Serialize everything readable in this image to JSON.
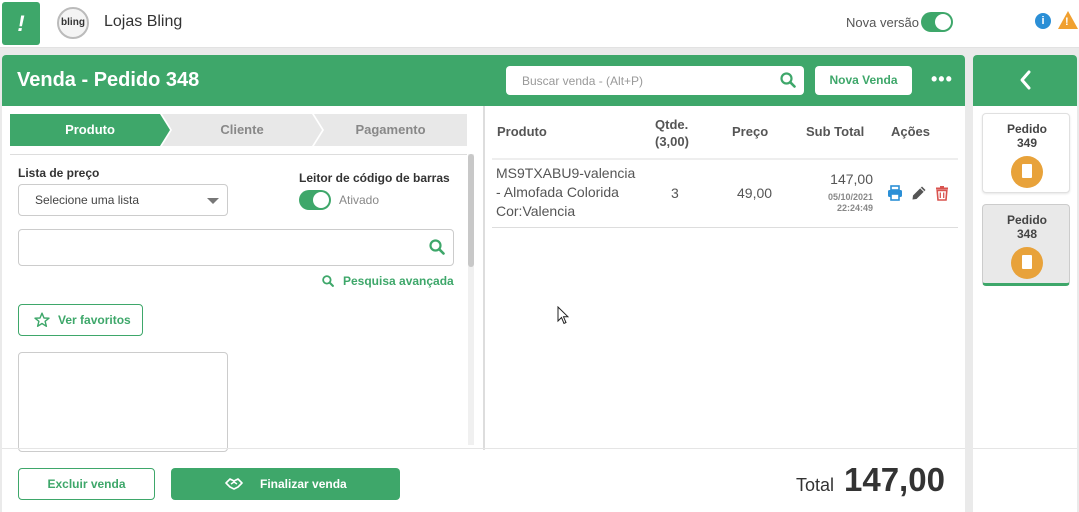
{
  "topbar": {
    "brand_icon": "!",
    "logo_text": "bling",
    "store_name": "Lojas Bling",
    "nova_versao_label": "Nova versão",
    "nova_versao_on": true,
    "info_icon": "i",
    "warning_icon": "!"
  },
  "header": {
    "title": "Venda - Pedido 348",
    "search_placeholder": "Buscar venda - (Alt+P)",
    "new_sale_label": "Nova Venda",
    "more_icon": "•••"
  },
  "steps": [
    {
      "label": "Produto",
      "active": true
    },
    {
      "label": "Cliente",
      "active": false
    },
    {
      "label": "Pagamento",
      "active": false
    }
  ],
  "left_panel": {
    "price_list_label": "Lista de preço",
    "price_list_value": "Selecione uma lista",
    "barcode_label": "Leitor de código de barras",
    "barcode_status": "Ativado",
    "barcode_on": true,
    "product_search_value": "",
    "advanced_search_label": "Pesquisa avançada",
    "favorites_label": "Ver favoritos"
  },
  "table": {
    "headers": {
      "product": "Produto",
      "qty": "Qtde.",
      "qty_total": "(3,00)",
      "price": "Preço",
      "subtotal": "Sub Total",
      "actions": "Ações"
    },
    "rows": [
      {
        "product_line1": "MS9TXABU9-valencia",
        "product_line2": "- Almofada Colorida",
        "product_line3": "Cor:Valencia",
        "qty": "3",
        "price": "49,00",
        "subtotal": "147,00",
        "date": "05/10/2021",
        "time": "22:24:49"
      }
    ]
  },
  "footer": {
    "delete_label": "Excluir venda",
    "finish_label": "Finalizar venda",
    "total_label": "Total",
    "total_value": "147,00"
  },
  "sidebar": {
    "orders": [
      {
        "label_line1": "Pedido",
        "label_line2": "349",
        "selected": false
      },
      {
        "label_line1": "Pedido",
        "label_line2": "348",
        "selected": true
      }
    ]
  },
  "colors": {
    "accent": "#3ea76a",
    "doc_badge": "#e8a23a",
    "info": "#2b8fd6",
    "warning": "#f0a030",
    "delete": "#d9534f",
    "print": "#2b8fd6"
  }
}
